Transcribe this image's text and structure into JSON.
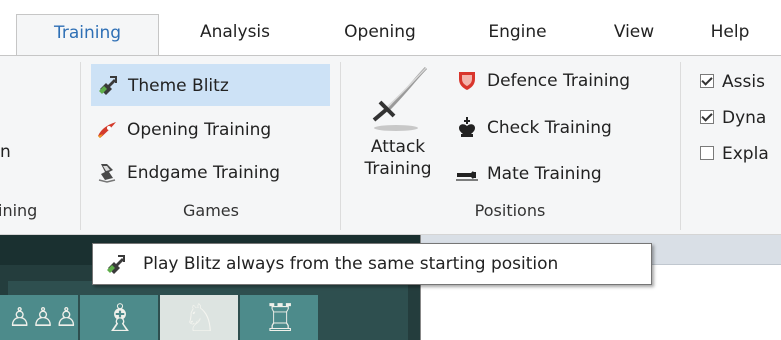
{
  "tabs": [
    {
      "label": "Training",
      "active": true
    },
    {
      "label": "Analysis",
      "active": false
    },
    {
      "label": "Opening",
      "active": false
    },
    {
      "label": "Engine",
      "active": false
    },
    {
      "label": "View",
      "active": false
    },
    {
      "label": "Help",
      "active": false
    }
  ],
  "ribbon": {
    "left_group": {
      "cut_item_text": "n",
      "group_label": "ining"
    },
    "games": {
      "group_label": "Games",
      "items": [
        {
          "label": "Theme Blitz",
          "icon": "theme-blitz-icon",
          "hovered": true
        },
        {
          "label": "Opening Training",
          "icon": "opening-training-icon",
          "hovered": false
        },
        {
          "label": "Endgame Training",
          "icon": "endgame-training-icon",
          "hovered": false
        }
      ]
    },
    "positions": {
      "group_label": "Positions",
      "attack_training": {
        "line1": "Attack",
        "line2": "Training",
        "icon": "sword-icon"
      },
      "items": [
        {
          "label": "Defence Training",
          "icon": "shield-icon"
        },
        {
          "label": "Check Training",
          "icon": "king-icon"
        },
        {
          "label": "Mate Training",
          "icon": "fallen-king-icon"
        }
      ]
    },
    "options": {
      "checkboxes": [
        {
          "label": "Assis",
          "checked": true
        },
        {
          "label": "Dyna",
          "checked": true
        },
        {
          "label": "Expla",
          "checked": false
        }
      ]
    }
  },
  "tooltip": {
    "text": "Play Blitz always from the same starting position",
    "icon": "theme-blitz-icon"
  },
  "board": {
    "pieces": [
      "♙♙♙",
      "♗",
      "♘",
      "♖"
    ]
  },
  "colors": {
    "accent": "#2e6fb5",
    "hover": "#cde2f6",
    "ribbon_bg": "#f5f6f7",
    "board_dark": "#4d8b8b",
    "board_light": "#dde4e1"
  }
}
